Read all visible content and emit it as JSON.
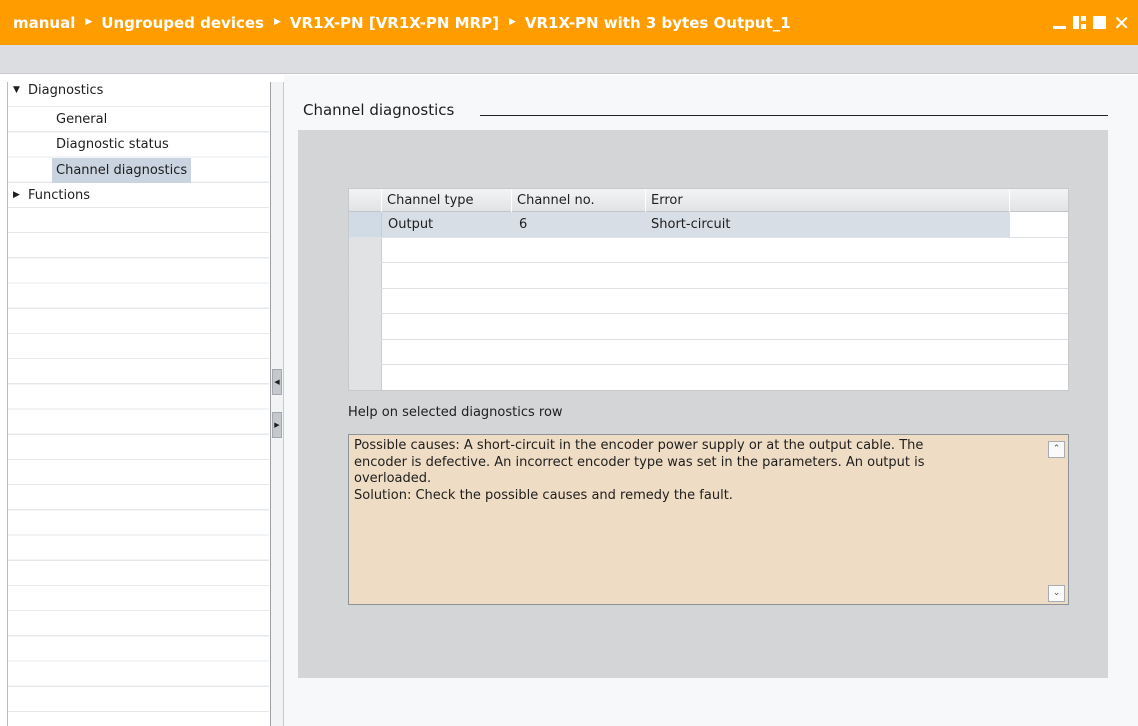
{
  "titlebar": {
    "breadcrumbs": [
      "manual",
      "Ungrouped devices",
      "VR1X-PN [VR1X-PN MRP]",
      "VR1X-PN with 3 bytes Output_1"
    ],
    "separator_icon": "triangle-right",
    "accent_color": "#ff9d00"
  },
  "tree": {
    "items": [
      {
        "label": "Diagnostics",
        "expanded": true
      },
      {
        "label": "General"
      },
      {
        "label": "Diagnostic status"
      },
      {
        "label": "Channel diagnostics",
        "selected": true
      },
      {
        "label": "Functions",
        "expanded": false
      }
    ]
  },
  "section": {
    "title": "Channel diagnostics"
  },
  "table": {
    "columns": [
      "Channel type",
      "Channel no.",
      "Error"
    ],
    "rows": [
      [
        "Output",
        "6",
        "Short-circuit"
      ]
    ]
  },
  "help": {
    "label": "Help on selected diagnostics row",
    "lines": [
      "Possible causes: A short-circuit in the encoder power supply or at the output cable. The",
      "encoder is defective. An incorrect encoder type was set in the parameters. An output is",
      "overloaded.",
      "Solution: Check the possible causes and remedy the fault."
    ],
    "background_color": "#efdcc4"
  }
}
